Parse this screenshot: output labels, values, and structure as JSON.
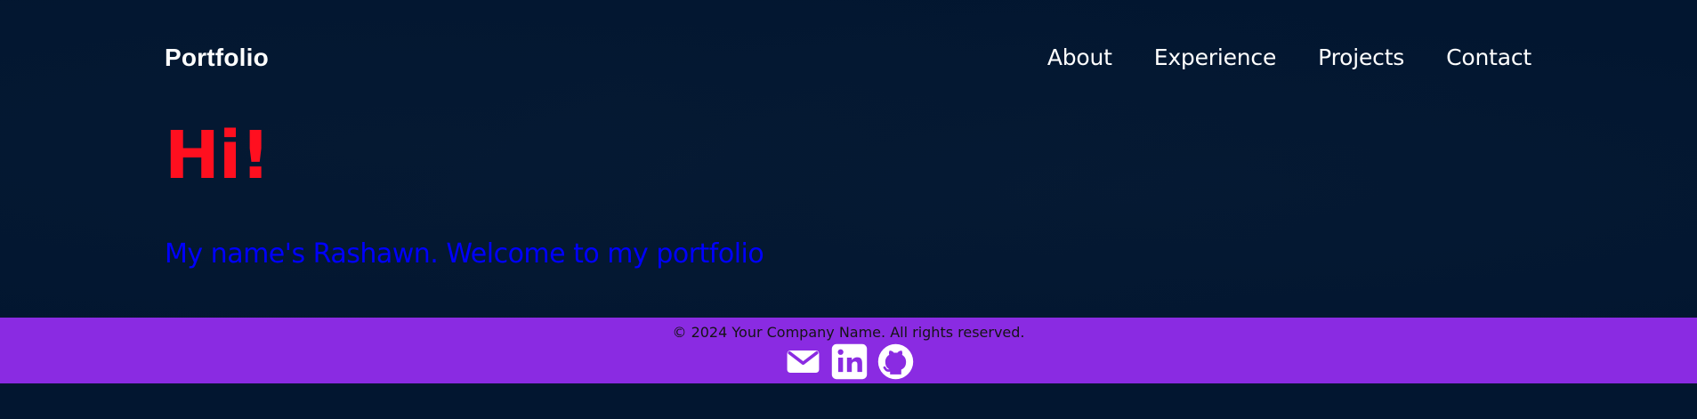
{
  "header": {
    "brand": "Portfolio",
    "nav_items": [
      {
        "label": "About"
      },
      {
        "label": "Experience"
      },
      {
        "label": "Projects"
      },
      {
        "label": "Contact"
      }
    ]
  },
  "hero": {
    "heading": "Hi!",
    "subtitle": "My name's Rashawn. Welcome to my portfolio"
  },
  "footer": {
    "copyright": "© 2024 Your Company Name. All rights reserved.",
    "social_icons": [
      "envelope-icon",
      "linkedin-icon",
      "github-icon"
    ]
  },
  "colors": {
    "page_background": "#021630",
    "heading": "#ff0f1f",
    "subtitle": "#0000ff",
    "footer_background": "#8a2be2",
    "text_light": "#ffffff"
  }
}
